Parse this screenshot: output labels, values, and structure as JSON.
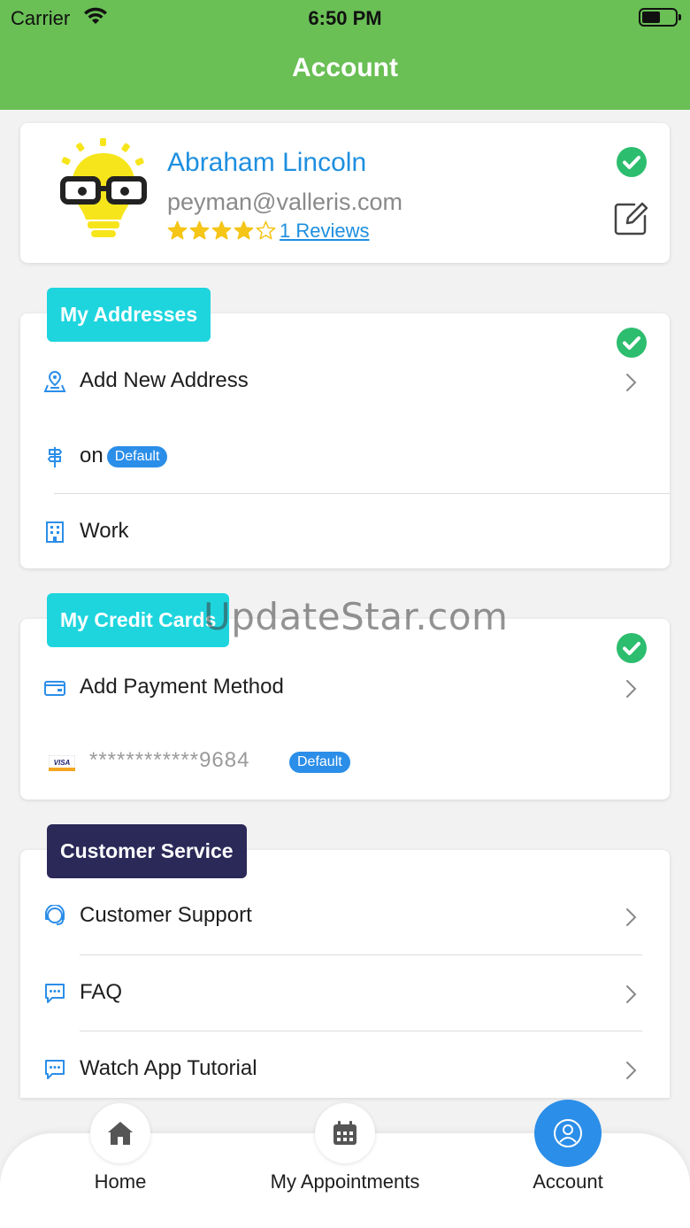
{
  "status_bar": {
    "carrier": "Carrier",
    "time": "6:50 PM"
  },
  "nav": {
    "title": "Account"
  },
  "profile": {
    "name": "Abraham Lincoln",
    "email": "peyman@valleris.com",
    "rating": 4,
    "rating_max": 5,
    "reviews_link": "1 Reviews"
  },
  "addresses": {
    "tag": "My Addresses",
    "add_label": "Add New Address",
    "items": [
      {
        "label": "on",
        "badge": "Default"
      },
      {
        "label": "Work"
      }
    ]
  },
  "credit_cards": {
    "tag": "My Credit Cards",
    "add_label": "Add Payment Method",
    "card": {
      "brand": "VISA",
      "masked": "************9684",
      "badge": "Default"
    }
  },
  "customer_service": {
    "tag": "Customer Service",
    "items": [
      "Customer Support",
      "FAQ",
      "Watch App Tutorial"
    ]
  },
  "bottom_nav": {
    "tabs": [
      {
        "label": "Home",
        "icon": "home-icon"
      },
      {
        "label": "My Appointments",
        "icon": "calendar-icon"
      },
      {
        "label": "Account",
        "icon": "account-icon",
        "active": true
      }
    ]
  },
  "watermark": "UpdateStar.com",
  "colors": {
    "header": "#6abf55",
    "accent_blue": "#1e8fe0",
    "tag_teal": "#1ed5de",
    "tag_navy": "#2b2958",
    "badge_blue": "#2b8ee8",
    "check_green": "#2dbd6e"
  }
}
